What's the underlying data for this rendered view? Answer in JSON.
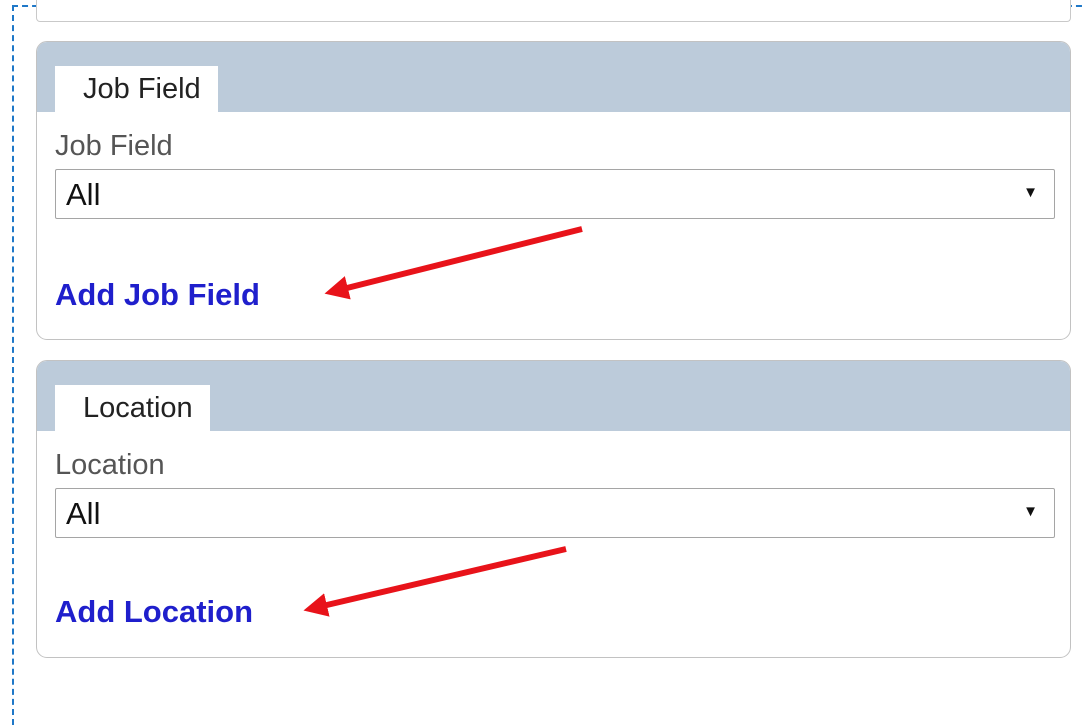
{
  "job_field_panel": {
    "tab_label": "Job Field",
    "field_label": "Job Field",
    "select_value": "All",
    "add_link": "Add Job Field"
  },
  "location_panel": {
    "tab_label": "Location",
    "field_label": "Location",
    "select_value": "All",
    "add_link": "Add Location"
  },
  "annotation": {
    "arrow_color": "#e8131a"
  },
  "colors": {
    "header_bg": "#bccbda",
    "link": "#1f1fcc",
    "frame_border": "#1f78c8"
  },
  "icons": {
    "dropdown": "chevron-down-icon",
    "annotation": "red-arrow-icon"
  }
}
